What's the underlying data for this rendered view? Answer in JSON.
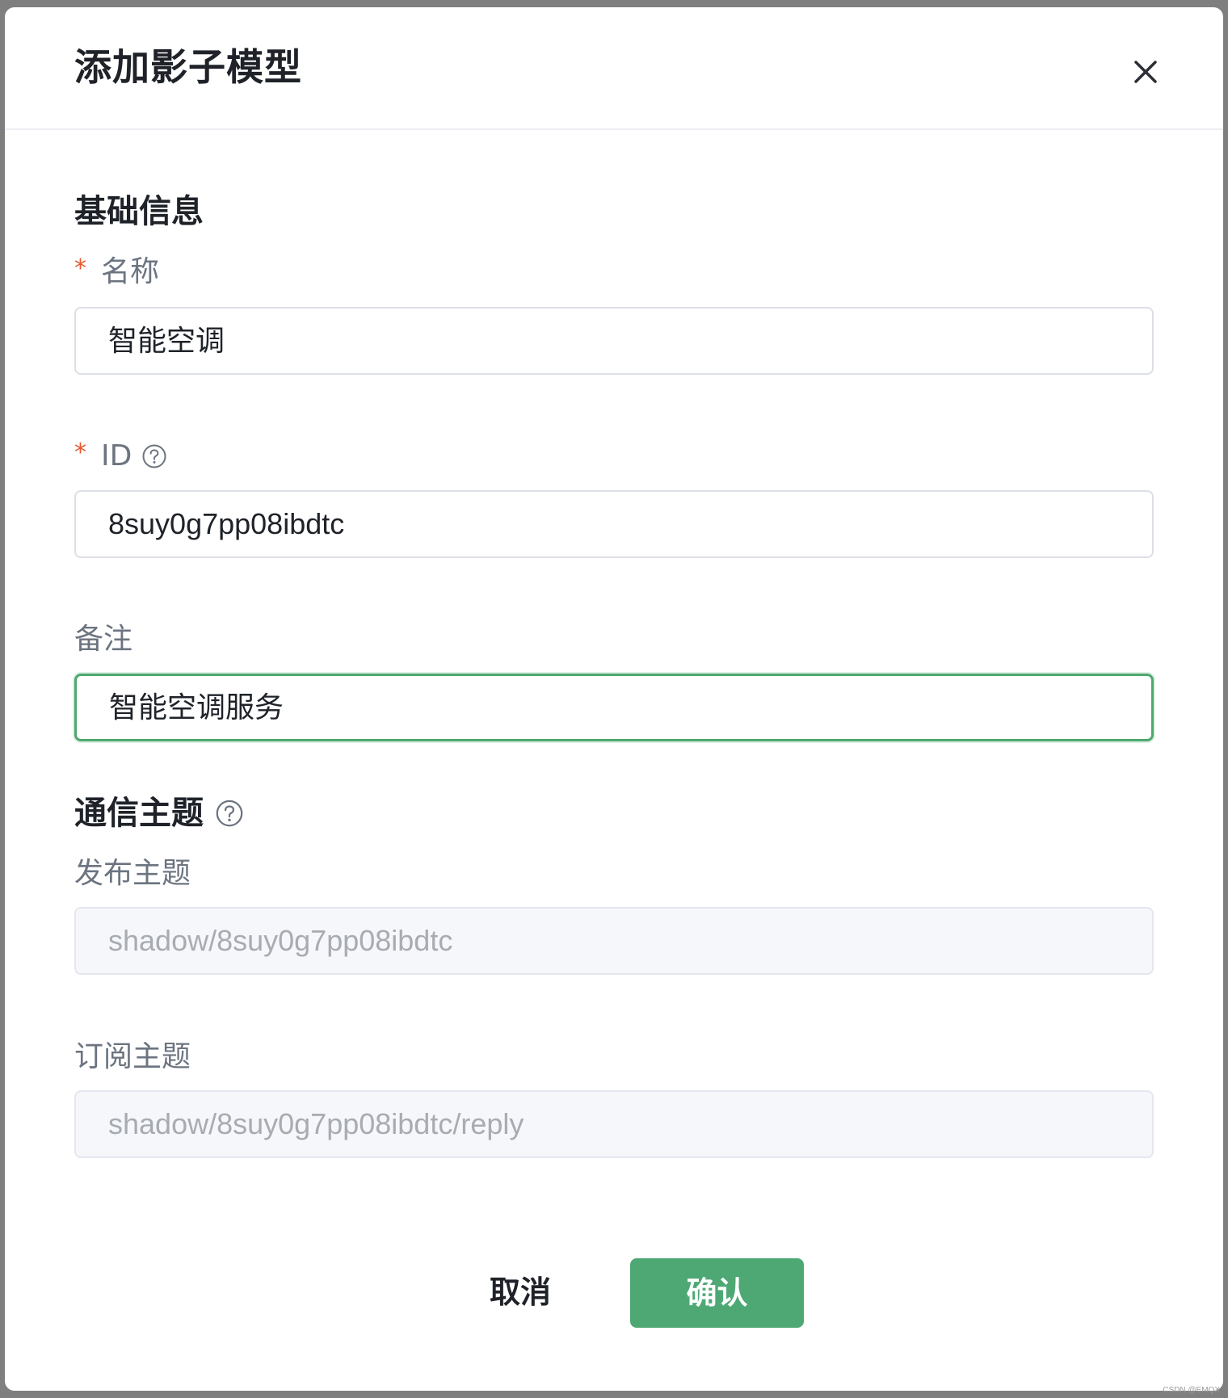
{
  "dialog": {
    "title": "添加影子模型",
    "close_icon": "close-icon"
  },
  "basic_info": {
    "section_title": "基础信息",
    "name": {
      "required_mark": "*",
      "label": "名称",
      "value": "智能空调"
    },
    "id": {
      "required_mark": "*",
      "label": "ID",
      "help_icon": "question-circle-icon",
      "value": "8suy0g7pp08ibdtc"
    },
    "remark": {
      "label": "备注",
      "value": "智能空调服务"
    }
  },
  "topics": {
    "section_title": "通信主题",
    "help_icon": "question-circle-icon",
    "publish": {
      "label": "发布主题",
      "value": "shadow/8suy0g7pp08ibdtc"
    },
    "subscribe": {
      "label": "订阅主题",
      "value": "shadow/8suy0g7pp08ibdtc/reply"
    }
  },
  "footer": {
    "cancel_label": "取消",
    "confirm_label": "确认"
  },
  "watermark": "CSDN @EMQX",
  "colors": {
    "accent": "#4ea874",
    "required": "#e8582f",
    "disabled_bg": "#f5f7fa",
    "overlay": "#7f7f7f"
  }
}
